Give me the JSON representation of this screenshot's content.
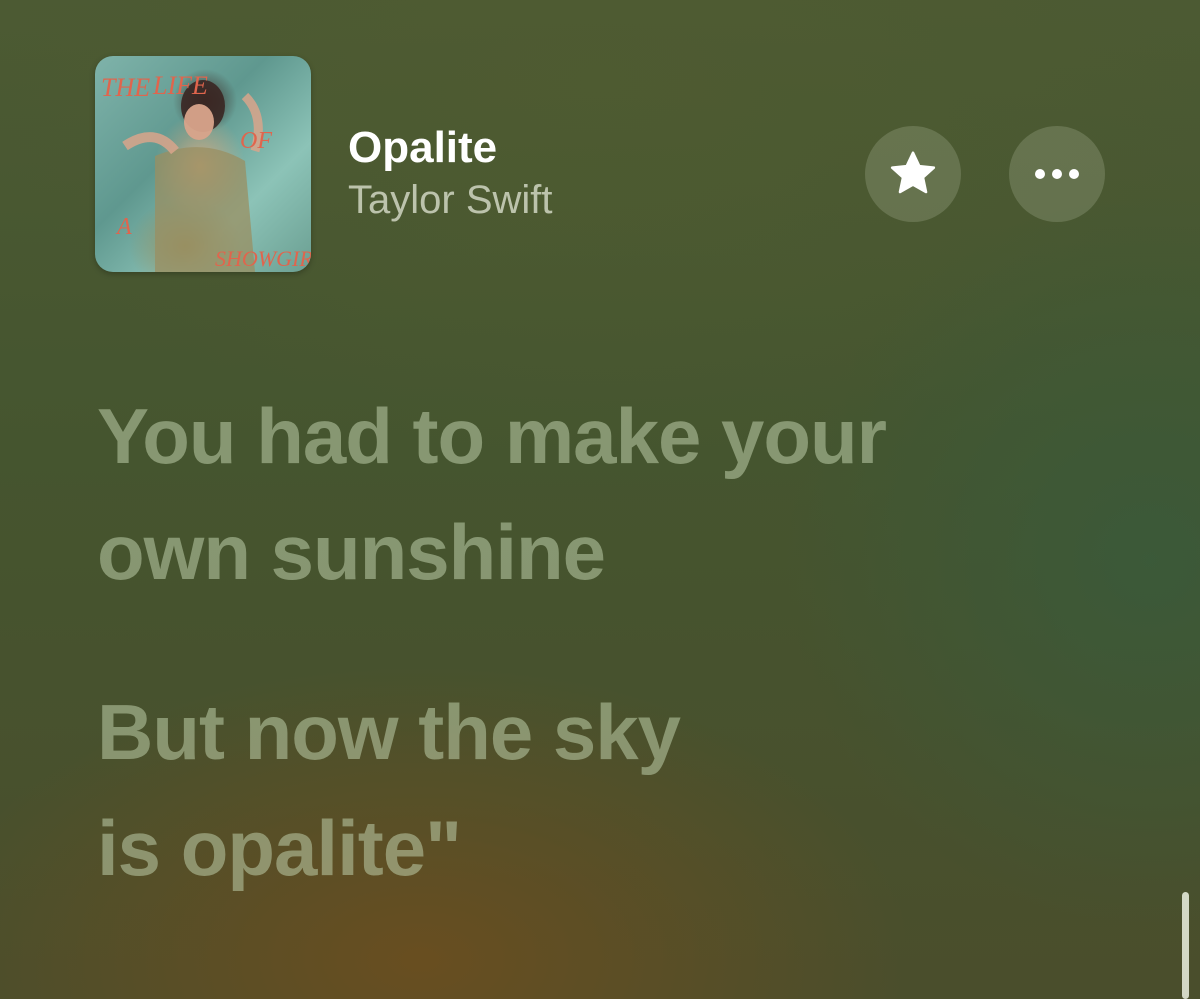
{
  "now_playing": {
    "album_art": {
      "icon": "album-cover",
      "cover_text": [
        "THE",
        "LIFE",
        "OF",
        "A",
        "SHOWGIRL"
      ]
    },
    "title": "Opalite",
    "artist": "Taylor Swift",
    "favorite_icon": "star-icon",
    "more_icon": "ellipsis-icon"
  },
  "lyrics": [
    {
      "text": "You had to make your\nown sunshine"
    },
    {
      "text": "But now the sky\nis opalite\""
    }
  ],
  "colors": {
    "title": "#ffffff",
    "artist": "#c9cfbf",
    "lyric_inactive": "#8fa07c",
    "button_bg": "#6b7a58",
    "background": "#4a5731"
  }
}
